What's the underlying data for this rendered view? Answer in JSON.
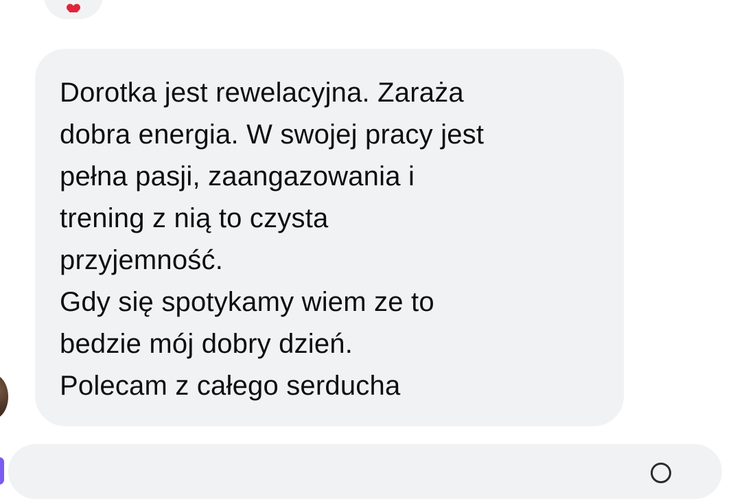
{
  "previous_message": {
    "reaction_icon": "heart-icon",
    "reaction_color": "#e0253a"
  },
  "message": {
    "lines": [
      "Dorotka jest rewelacyjna. Zaraża",
      "dobra energia. W swojej pracy jest",
      "pełna pasji, zaangazowania i",
      "trening z nią to czysta",
      "przyjemność.",
      "Gdy się spotykamy wiem ze to",
      "bedzie mój dobry dzień.",
      "Polecam z całego serducha"
    ],
    "bubble_color": "#f1f2f4",
    "text_color": "#0e0e10"
  },
  "composer": {
    "accent_color": "#7b5cf0"
  }
}
